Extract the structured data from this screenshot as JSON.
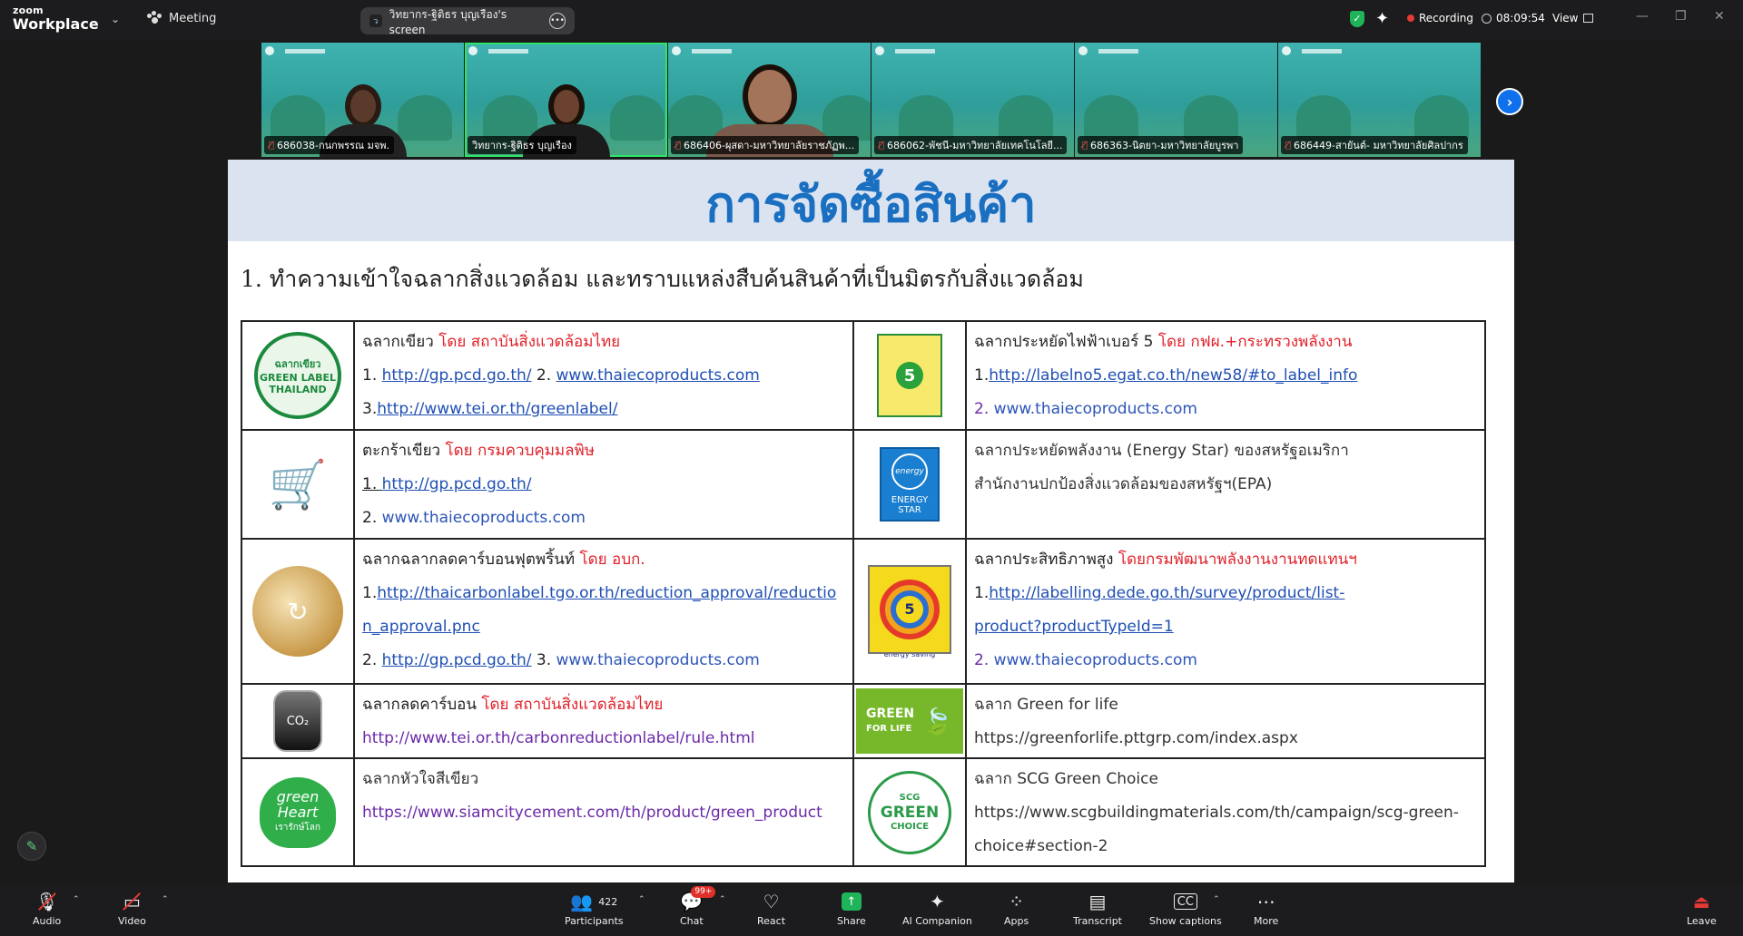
{
  "app": {
    "brand_top": "zoom",
    "brand_bottom": "Workplace",
    "meeting_label": "Meeting",
    "screen_share_label": "วิทยากร-ฐิติธร บุญเรือง's screen",
    "recording_label": "Recording",
    "timer": "08:09:54",
    "view_label": "View"
  },
  "participants_strip": [
    {
      "name": "686038-กนกพรรณ มจพ.",
      "muted": true
    },
    {
      "name": "วิทยากร-ฐิติธร บุญเรือง",
      "muted": false,
      "active": true
    },
    {
      "name": "686406-ผุสดา-มหาวิทยาลัยราชภัฏพ...",
      "muted": true
    },
    {
      "name": "686062-พัชนี-มหาวิทยาลัยเทคโนโลยี...",
      "muted": true
    },
    {
      "name": "686363-นิตยา-มหาวิทยาลัยบูรพา",
      "muted": true
    },
    {
      "name": "686449-สายันต์- มหาวิทยาลัยศิลปากร",
      "muted": true
    }
  ],
  "slide": {
    "title": "การจัดซื้อสินค้า",
    "subtitle": "1. ทำความเข้าใจฉลากสิ่งแวดล้อม และทราบแหล่งสืบค้นสินค้าที่เป็นมิตรกับสิ่งแวดล้อม",
    "rows": [
      {
        "left": {
          "logo_text": "ฉลากเขียว GREEN LABEL THAILAND",
          "name": "ฉลากเขียว ",
          "by": "โดย สถาบันสิ่งแวดล้อมไทย",
          "line2_prefix": "1. ",
          "line2_link1": "http://gp.pcd.go.th/",
          "line2_mid": " 2. ",
          "line2_link2": "www.thaiecoproducts.com",
          "line3_prefix": "3.",
          "line3_link": "http://www.tei.or.th/greenlabel/"
        },
        "right": {
          "logo_text": "5",
          "name": "ฉลากประหยัดไฟฟ้าเบอร์ 5 ",
          "by": "โดย กฟผ.+กระทรวงพลังงาน",
          "line2_prefix": "1.",
          "line2_link": "http://labelno5.egat.co.th/new58/#to_label_info",
          "line3_prefix": "2. ",
          "line3_link": "www.thaiecoproducts.com"
        }
      },
      {
        "left": {
          "logo_text": "ตะกร้าเขียว",
          "name": "ตะกร้าเขียว ",
          "by": "โดย กรมควบคุมมลพิษ",
          "line2_prefix": "1. ",
          "line2_link": "http://gp.pcd.go.th/",
          "line3_prefix": "2. ",
          "line3_link": "www.thaiecoproducts.com"
        },
        "right": {
          "logo_text": "ENERGY STAR",
          "logo_script": "energy",
          "line1": "ฉลากประหยัดพลังงาน (Energy Star) ของสหรัฐอเมริกา",
          "line2": "สำนักงานปกป้องสิ่งแวดล้อมของสหรัฐฯ(EPA)"
        }
      },
      {
        "left": {
          "name": "ฉลากฉลากลดคาร์บอนฟุตพริ้นท์ ",
          "by": "โดย อบก.",
          "line2_prefix": "1.",
          "line2_link_a": "http://thaicarbonlabel.tgo.or.th/reduction_approval/reductio",
          "line2_link_b": "n_approval.pnc",
          "line3_prefix": "2. ",
          "line3_link1": "http://gp.pcd.go.th/",
          "line3_mid": " 3. ",
          "line3_link2": "www.thaiecoproducts.com"
        },
        "right": {
          "logo_text": "5",
          "logo_caption": "energy saving",
          "name": "ฉลากประสิทธิภาพสูง ",
          "by": "โดยกรมพัฒนาพลังงานงานทดแทนฯ",
          "line2_prefix": "1.",
          "line2_link_a": "http://labelling.dede.go.th/survey/product/list-",
          "line2_link_b": "product?productTypeId=1",
          "line3_prefix": "2. ",
          "line3_link": "www.thaiecoproducts.com"
        }
      },
      {
        "left": {
          "logo_text": "CO₂",
          "name": "ฉลากลดคาร์บอน ",
          "by": "โดย สถาบันสิ่งแวดล้อมไทย",
          "line2": "http://www.tei.or.th/carbonreductionlabel/rule.html"
        },
        "right": {
          "logo_text_1": "GREEN",
          "logo_text_2": "FOR LIFE",
          "name": "ฉลาก Green for life",
          "line2": "https://greenforlife.pttgrp.com/index.aspx"
        }
      },
      {
        "left": {
          "logo_text_1": "green",
          "logo_text_2": "Heart",
          "logo_text_3": "เรารักษ์โลก",
          "name": "ฉลากหัวใจสีเขียว",
          "line2": "https://www.siamcitycement.com/th/product/green_product"
        },
        "right": {
          "logo_text_1": "SCG",
          "logo_text_2": "GREEN",
          "logo_text_3": "CHOICE",
          "name": "ฉลาก SCG Green Choice",
          "line2": "https://www.scgbuildingmaterials.com/th/campaign/scg-green-",
          "line3": "choice#section-2"
        }
      }
    ]
  },
  "toolbar": {
    "audio": "Audio",
    "video": "Video",
    "participants": "Participants",
    "participants_count": "422",
    "chat": "Chat",
    "chat_badge": "99+",
    "react": "React",
    "share": "Share",
    "ai": "AI Companion",
    "apps": "Apps",
    "transcript": "Transcript",
    "captions": "Show captions",
    "more": "More",
    "leave": "Leave"
  },
  "colors": {
    "accent_blue": "#0e71eb",
    "title_blue": "#1a6fc0",
    "red_text": "#e0212a",
    "share_green": "#1fb35a"
  }
}
